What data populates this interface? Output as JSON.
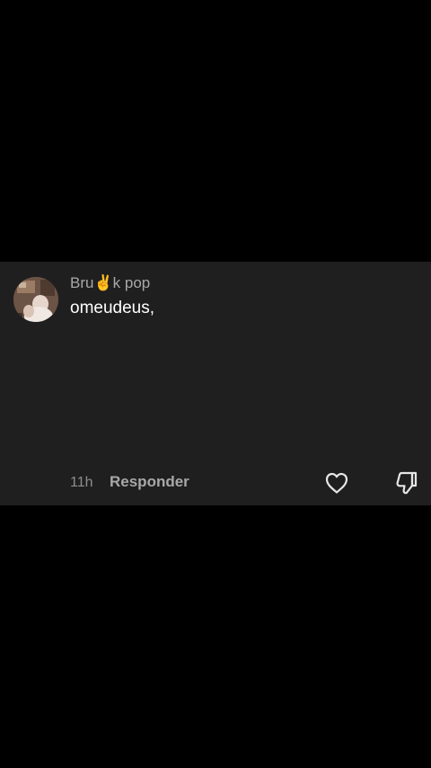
{
  "comment": {
    "username_prefix": "Bru",
    "username_emoji": "✌️",
    "username_suffix": "k pop",
    "text": "omeudeus,",
    "time": "11h",
    "reply_label": "Responder",
    "avatar_icon": "avatar-photo",
    "like_icon": "heart-outline-icon",
    "dislike_icon": "thumbs-down-outline-icon"
  },
  "colors": {
    "background": "#000000",
    "card": "#1f1f1f",
    "primary_text": "#ffffff",
    "secondary_text": "#a8a8a8"
  }
}
